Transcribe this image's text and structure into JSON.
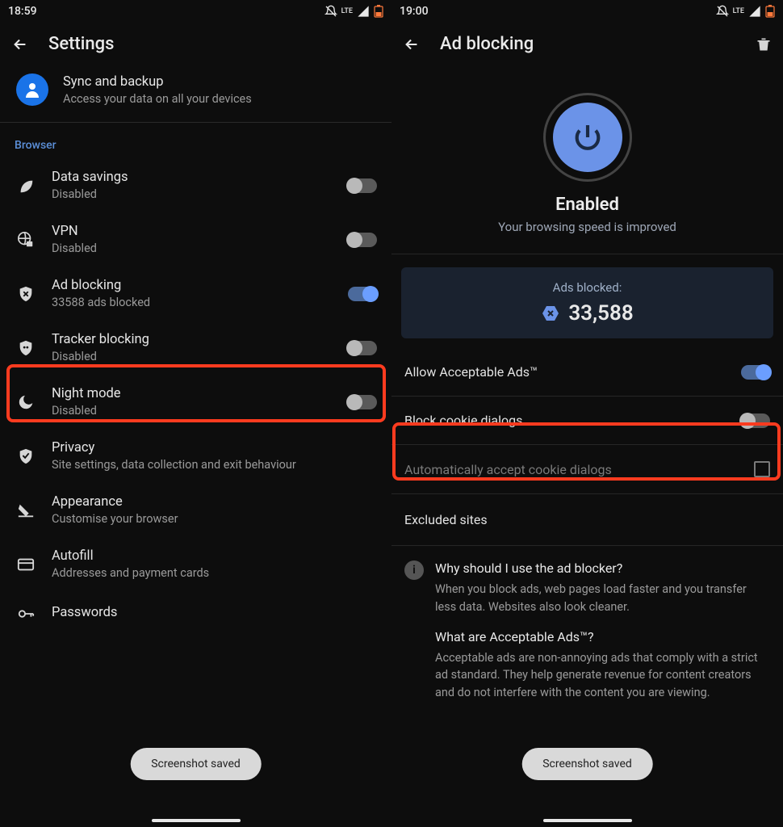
{
  "left": {
    "status_time": "18:59",
    "header_title": "Settings",
    "sync": {
      "title": "Sync and backup",
      "subtitle": "Access your data on all your devices"
    },
    "section_browser": "Browser",
    "rows": {
      "data_savings": {
        "title": "Data savings",
        "subtitle": "Disabled"
      },
      "vpn": {
        "title": "VPN",
        "subtitle": "Disabled"
      },
      "ad_blocking": {
        "title": "Ad blocking",
        "subtitle": "33588 ads blocked"
      },
      "tracker": {
        "title": "Tracker blocking",
        "subtitle": "Disabled"
      },
      "night": {
        "title": "Night mode",
        "subtitle": "Disabled"
      },
      "privacy": {
        "title": "Privacy",
        "subtitle": "Site settings, data collection and exit behaviour"
      },
      "appearance": {
        "title": "Appearance",
        "subtitle": "Customise your browser"
      },
      "autofill": {
        "title": "Autofill",
        "subtitle": "Addresses and payment cards"
      },
      "passwords": {
        "title": "Passwords"
      }
    },
    "toast": "Screenshot saved"
  },
  "right": {
    "status_time": "19:00",
    "header_title": "Ad blocking",
    "enabled_title": "Enabled",
    "enabled_sub": "Your browsing speed is improved",
    "ads_label": "Ads blocked:",
    "ads_count": "33,588",
    "allow_ads": "Allow Acceptable Ads™",
    "block_cookie": "Block cookie dialogs",
    "auto_accept": "Automatically accept cookie dialogs",
    "excluded": "Excluded sites",
    "q1": "Why should I use the ad blocker?",
    "a1": "When you block ads, web pages load faster and you transfer less data. Websites also look cleaner.",
    "q2": "What are Acceptable Ads™?",
    "a2": "Acceptable ads are non-annoying ads that comply with a strict ad standard. They help generate revenue for content creators and do not interfere with the content you are viewing.",
    "toast": "Screenshot saved"
  },
  "status_lte": "LTE"
}
